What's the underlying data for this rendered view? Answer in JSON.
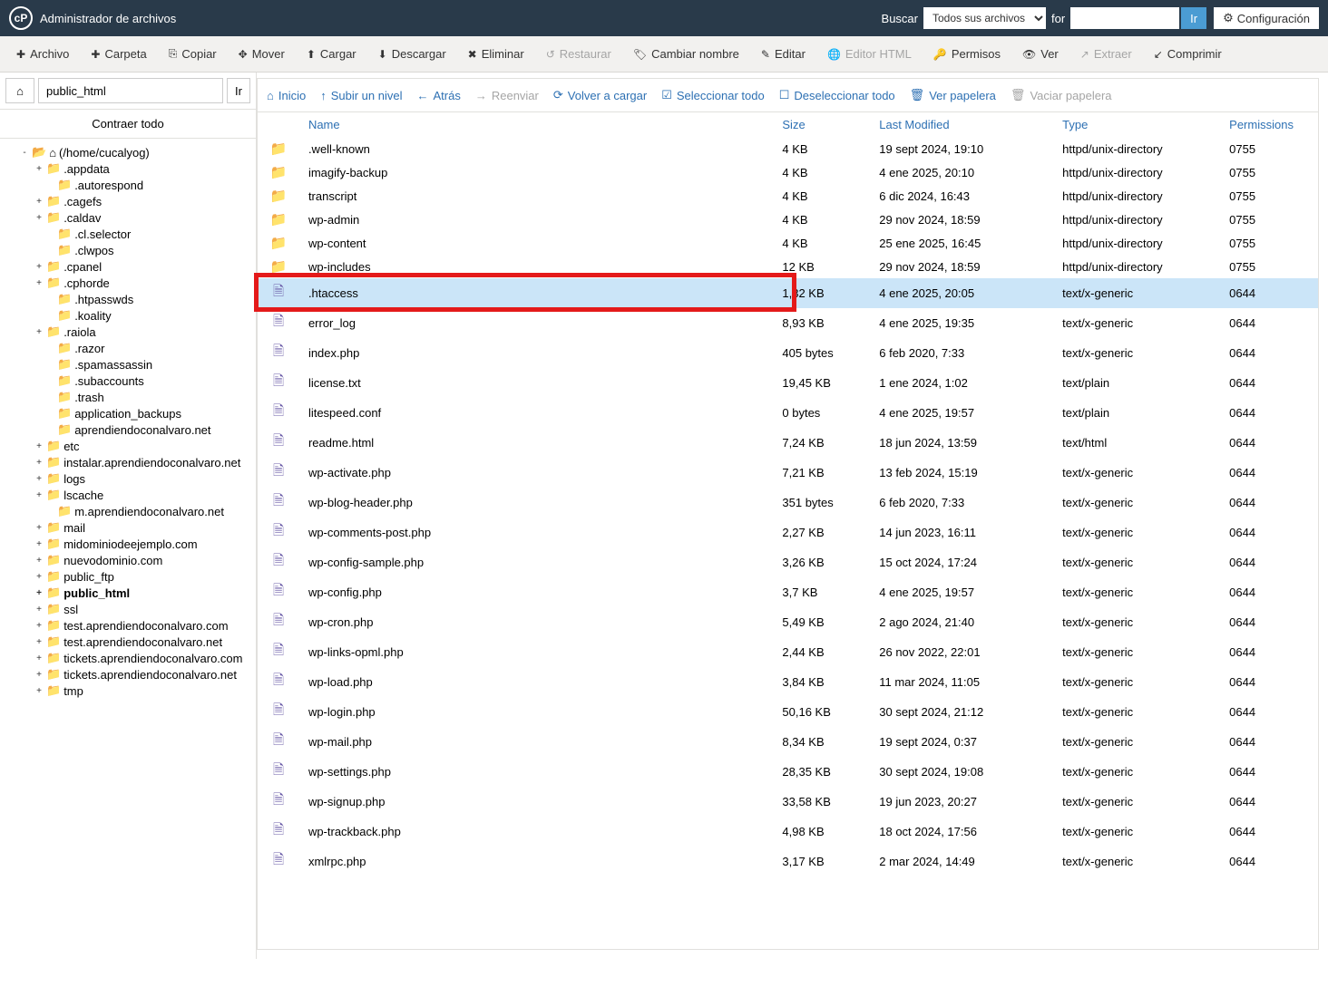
{
  "app_title": "Administrador de archivos",
  "topbar": {
    "search_label": "Buscar",
    "search_scope": "Todos sus archivos",
    "for_label": "for",
    "search_value": "",
    "go": "Ir",
    "settings": "Configuración"
  },
  "toolbar": [
    {
      "id": "file",
      "label": "Archivo",
      "icon": "plus"
    },
    {
      "id": "folder",
      "label": "Carpeta",
      "icon": "plus"
    },
    {
      "id": "copy",
      "label": "Copiar",
      "icon": "copy"
    },
    {
      "id": "move",
      "label": "Mover",
      "icon": "move"
    },
    {
      "id": "upload",
      "label": "Cargar",
      "icon": "upload"
    },
    {
      "id": "download",
      "label": "Descargar",
      "icon": "download"
    },
    {
      "id": "delete",
      "label": "Eliminar",
      "icon": "x"
    },
    {
      "id": "restore",
      "label": "Restaurar",
      "icon": "undo",
      "disabled": true
    },
    {
      "id": "rename",
      "label": "Cambiar nombre",
      "icon": "tag"
    },
    {
      "id": "edit",
      "label": "Editar",
      "icon": "pencil"
    },
    {
      "id": "html",
      "label": "Editor HTML",
      "icon": "globe",
      "disabled": true
    },
    {
      "id": "perms",
      "label": "Permisos",
      "icon": "key"
    },
    {
      "id": "view",
      "label": "Ver",
      "icon": "eye"
    },
    {
      "id": "extract",
      "label": "Extraer",
      "icon": "extract",
      "disabled": true
    },
    {
      "id": "compress",
      "label": "Comprimir",
      "icon": "compress"
    }
  ],
  "sidebar": {
    "path_input": "public_html",
    "go": "Ir",
    "collapse_all": "Contraer todo",
    "tree": [
      {
        "d": 0,
        "exp": "-",
        "label": "(/home/cucalyog)",
        "open": true,
        "home": true
      },
      {
        "d": 1,
        "exp": "+",
        "label": ".appdata"
      },
      {
        "d": 2,
        "exp": "",
        "label": ".autorespond"
      },
      {
        "d": 1,
        "exp": "+",
        "label": ".cagefs"
      },
      {
        "d": 1,
        "exp": "+",
        "label": ".caldav"
      },
      {
        "d": 2,
        "exp": "",
        "label": ".cl.selector"
      },
      {
        "d": 2,
        "exp": "",
        "label": ".clwpos"
      },
      {
        "d": 1,
        "exp": "+",
        "label": ".cpanel"
      },
      {
        "d": 1,
        "exp": "+",
        "label": ".cphorde"
      },
      {
        "d": 2,
        "exp": "",
        "label": ".htpasswds"
      },
      {
        "d": 2,
        "exp": "",
        "label": ".koality"
      },
      {
        "d": 1,
        "exp": "+",
        "label": ".raiola"
      },
      {
        "d": 2,
        "exp": "",
        "label": ".razor"
      },
      {
        "d": 2,
        "exp": "",
        "label": ".spamassassin"
      },
      {
        "d": 2,
        "exp": "",
        "label": ".subaccounts"
      },
      {
        "d": 2,
        "exp": "",
        "label": ".trash"
      },
      {
        "d": 2,
        "exp": "",
        "label": "application_backups"
      },
      {
        "d": 2,
        "exp": "",
        "label": "aprendiendoconalvaro.net"
      },
      {
        "d": 1,
        "exp": "+",
        "label": "etc"
      },
      {
        "d": 1,
        "exp": "+",
        "label": "instalar.aprendiendoconalvaro.net"
      },
      {
        "d": 1,
        "exp": "+",
        "label": "logs"
      },
      {
        "d": 1,
        "exp": "+",
        "label": "lscache"
      },
      {
        "d": 2,
        "exp": "",
        "label": "m.aprendiendoconalvaro.net"
      },
      {
        "d": 1,
        "exp": "+",
        "label": "mail"
      },
      {
        "d": 1,
        "exp": "+",
        "label": "midominiodeejemplo.com"
      },
      {
        "d": 1,
        "exp": "+",
        "label": "nuevodominio.com"
      },
      {
        "d": 1,
        "exp": "+",
        "label": "public_ftp"
      },
      {
        "d": 1,
        "exp": "+",
        "label": "public_html",
        "bold": true
      },
      {
        "d": 1,
        "exp": "+",
        "label": "ssl"
      },
      {
        "d": 1,
        "exp": "+",
        "label": "test.aprendiendoconalvaro.com"
      },
      {
        "d": 1,
        "exp": "+",
        "label": "test.aprendiendoconalvaro.net"
      },
      {
        "d": 1,
        "exp": "+",
        "label": "tickets.aprendiendoconalvaro.com"
      },
      {
        "d": 1,
        "exp": "+",
        "label": "tickets.aprendiendoconalvaro.net"
      },
      {
        "d": 1,
        "exp": "+",
        "label": "tmp"
      }
    ]
  },
  "content_toolbar": [
    {
      "id": "home",
      "label": "Inicio",
      "icon": "home"
    },
    {
      "id": "up",
      "label": "Subir un nivel",
      "icon": "up"
    },
    {
      "id": "back",
      "label": "Atrás",
      "icon": "left"
    },
    {
      "id": "fwd",
      "label": "Reenviar",
      "icon": "right",
      "disabled": true
    },
    {
      "id": "reload",
      "label": "Volver a cargar",
      "icon": "reload"
    },
    {
      "id": "selall",
      "label": "Seleccionar todo",
      "icon": "check"
    },
    {
      "id": "desel",
      "label": "Deseleccionar todo",
      "icon": "uncheck"
    },
    {
      "id": "trash",
      "label": "Ver papelera",
      "icon": "trash"
    },
    {
      "id": "empty",
      "label": "Vaciar papelera",
      "icon": "trash",
      "disabled": true
    }
  ],
  "table": {
    "headers": {
      "name": "Name",
      "size": "Size",
      "modified": "Last Modified",
      "type": "Type",
      "perm": "Permissions"
    },
    "rows": [
      {
        "kind": "dir",
        "name": ".well-known",
        "size": "4 KB",
        "mod": "19 sept 2024, 19:10",
        "type": "httpd/unix-directory",
        "perm": "0755"
      },
      {
        "kind": "dir",
        "name": "imagify-backup",
        "size": "4 KB",
        "mod": "4 ene 2025, 20:10",
        "type": "httpd/unix-directory",
        "perm": "0755"
      },
      {
        "kind": "dir",
        "name": "transcript",
        "size": "4 KB",
        "mod": "6 dic 2024, 16:43",
        "type": "httpd/unix-directory",
        "perm": "0755"
      },
      {
        "kind": "dir",
        "name": "wp-admin",
        "size": "4 KB",
        "mod": "29 nov 2024, 18:59",
        "type": "httpd/unix-directory",
        "perm": "0755"
      },
      {
        "kind": "dir",
        "name": "wp-content",
        "size": "4 KB",
        "mod": "25 ene 2025, 16:45",
        "type": "httpd/unix-directory",
        "perm": "0755"
      },
      {
        "kind": "dir",
        "name": "wp-includes",
        "size": "12 KB",
        "mod": "29 nov 2024, 18:59",
        "type": "httpd/unix-directory",
        "perm": "0755"
      },
      {
        "kind": "file",
        "name": ".htaccess",
        "size": "1,32 KB",
        "mod": "4 ene 2025, 20:05",
        "type": "text/x-generic",
        "perm": "0644",
        "selected": true
      },
      {
        "kind": "file",
        "name": "error_log",
        "size": "8,93 KB",
        "mod": "4 ene 2025, 19:35",
        "type": "text/x-generic",
        "perm": "0644"
      },
      {
        "kind": "file",
        "name": "index.php",
        "size": "405 bytes",
        "mod": "6 feb 2020, 7:33",
        "type": "text/x-generic",
        "perm": "0644"
      },
      {
        "kind": "file",
        "name": "license.txt",
        "size": "19,45 KB",
        "mod": "1 ene 2024, 1:02",
        "type": "text/plain",
        "perm": "0644"
      },
      {
        "kind": "file",
        "name": "litespeed.conf",
        "size": "0 bytes",
        "mod": "4 ene 2025, 19:57",
        "type": "text/plain",
        "perm": "0644"
      },
      {
        "kind": "html",
        "name": "readme.html",
        "size": "7,24 KB",
        "mod": "18 jun 2024, 13:59",
        "type": "text/html",
        "perm": "0644"
      },
      {
        "kind": "file",
        "name": "wp-activate.php",
        "size": "7,21 KB",
        "mod": "13 feb 2024, 15:19",
        "type": "text/x-generic",
        "perm": "0644"
      },
      {
        "kind": "file",
        "name": "wp-blog-header.php",
        "size": "351 bytes",
        "mod": "6 feb 2020, 7:33",
        "type": "text/x-generic",
        "perm": "0644"
      },
      {
        "kind": "file",
        "name": "wp-comments-post.php",
        "size": "2,27 KB",
        "mod": "14 jun 2023, 16:11",
        "type": "text/x-generic",
        "perm": "0644"
      },
      {
        "kind": "file",
        "name": "wp-config-sample.php",
        "size": "3,26 KB",
        "mod": "15 oct 2024, 17:24",
        "type": "text/x-generic",
        "perm": "0644"
      },
      {
        "kind": "file",
        "name": "wp-config.php",
        "size": "3,7 KB",
        "mod": "4 ene 2025, 19:57",
        "type": "text/x-generic",
        "perm": "0644"
      },
      {
        "kind": "file",
        "name": "wp-cron.php",
        "size": "5,49 KB",
        "mod": "2 ago 2024, 21:40",
        "type": "text/x-generic",
        "perm": "0644"
      },
      {
        "kind": "file",
        "name": "wp-links-opml.php",
        "size": "2,44 KB",
        "mod": "26 nov 2022, 22:01",
        "type": "text/x-generic",
        "perm": "0644"
      },
      {
        "kind": "file",
        "name": "wp-load.php",
        "size": "3,84 KB",
        "mod": "11 mar 2024, 11:05",
        "type": "text/x-generic",
        "perm": "0644"
      },
      {
        "kind": "file",
        "name": "wp-login.php",
        "size": "50,16 KB",
        "mod": "30 sept 2024, 21:12",
        "type": "text/x-generic",
        "perm": "0644"
      },
      {
        "kind": "file",
        "name": "wp-mail.php",
        "size": "8,34 KB",
        "mod": "19 sept 2024, 0:37",
        "type": "text/x-generic",
        "perm": "0644"
      },
      {
        "kind": "file",
        "name": "wp-settings.php",
        "size": "28,35 KB",
        "mod": "30 sept 2024, 19:08",
        "type": "text/x-generic",
        "perm": "0644"
      },
      {
        "kind": "file",
        "name": "wp-signup.php",
        "size": "33,58 KB",
        "mod": "19 jun 2023, 20:27",
        "type": "text/x-generic",
        "perm": "0644"
      },
      {
        "kind": "file",
        "name": "wp-trackback.php",
        "size": "4,98 KB",
        "mod": "18 oct 2024, 17:56",
        "type": "text/x-generic",
        "perm": "0644"
      },
      {
        "kind": "file",
        "name": "xmlrpc.php",
        "size": "3,17 KB",
        "mod": "2 mar 2024, 14:49",
        "type": "text/x-generic",
        "perm": "0644"
      }
    ]
  }
}
